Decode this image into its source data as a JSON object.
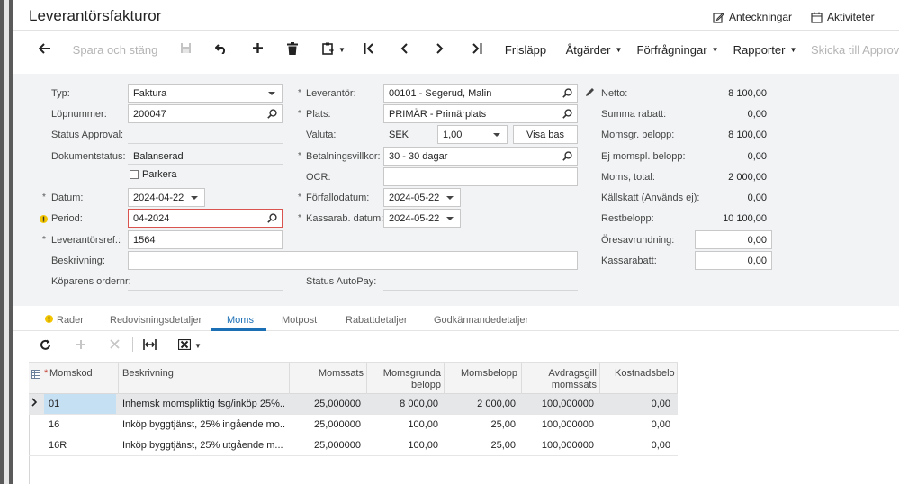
{
  "header": {
    "title": "Leverantörsfakturor",
    "notes_label": "Anteckningar",
    "activities_label": "Aktiviteter"
  },
  "toolbar": {
    "save_close": "Spara och stäng",
    "release": "Frisläpp",
    "actions": "Åtgärder",
    "inquiries": "Förfrågningar",
    "reports": "Rapporter",
    "send_approval": "Skicka till Approv"
  },
  "form": {
    "type_label": "Typ:",
    "type_value": "Faktura",
    "ref_label": "Löpnummer:",
    "ref_value": "200047",
    "status_approval_label": "Status Approval:",
    "doc_status_label": "Dokumentstatus:",
    "doc_status_value": "Balanserad",
    "hold_label": "Parkera",
    "date_label": "Datum:",
    "date_value": "2024-04-22",
    "period_label": "Period:",
    "period_value": "04-2024",
    "vendor_ref_label": "Leverantörsref.:",
    "vendor_ref_value": "1564",
    "description_label": "Beskrivning:",
    "buyer_order_label": "Köparens ordernr:",
    "vendor_label": "Leverantör:",
    "vendor_value": "00101 - Segerud, Malin",
    "location_label": "Plats:",
    "location_value": "PRIMÄR - Primärplats",
    "currency_label": "Valuta:",
    "currency_value": "SEK",
    "rate_value": "1,00",
    "view_base_label": "Visa bas",
    "terms_label": "Betalningsvillkor:",
    "terms_value": "30 - 30 dagar",
    "ocr_label": "OCR:",
    "due_date_label": "Förfallodatum:",
    "due_date_value": "2024-05-22",
    "cash_disc_date_label": "Kassarab. datum:",
    "cash_disc_date_value": "2024-05-22",
    "status_autopay_label": "Status AutoPay:"
  },
  "summary": {
    "net_label": "Netto:",
    "net_value": "8 100,00",
    "discount_total_label": "Summa rabatt:",
    "discount_total_value": "0,00",
    "taxable_label": "Momsgr. belopp:",
    "taxable_value": "8 100,00",
    "exempt_label": "Ej momspl. belopp:",
    "exempt_value": "0,00",
    "tax_total_label": "Moms, total:",
    "tax_total_value": "2 000,00",
    "withholding_label": "Källskatt (Används ej):",
    "withholding_value": "0,00",
    "balance_label": "Restbelopp:",
    "balance_value": "10 100,00",
    "rounding_label": "Öresavrundning:",
    "rounding_value": "0,00",
    "cash_discount_label": "Kassarabatt:",
    "cash_discount_value": "0,00"
  },
  "tabs": [
    "Rader",
    "Redovisningsdetaljer",
    "Moms",
    "Motpost",
    "Rabattdetaljer",
    "Godkännandedetaljer"
  ],
  "grid": {
    "headers": {
      "tax_id": "Momskod",
      "description": "Beskrivning",
      "rate": "Momssats",
      "taxable_1": "Momsgrunda",
      "taxable_2": "belopp",
      "tax_amount": "Momsbelopp",
      "deductible_1": "Avdragsgill",
      "deductible_2": "momssats",
      "expense": "Kostnadsbelo"
    },
    "rows": [
      {
        "tax_id": "01",
        "description": "Inhemsk momspliktig fsg/inköp 25%...",
        "rate": "25,000000",
        "taxable": "8 000,00",
        "tax_amount": "2 000,00",
        "deductible": "100,000000",
        "expense": "0,00"
      },
      {
        "tax_id": "16",
        "description": "Inköp byggtjänst, 25% ingående mo...",
        "rate": "25,000000",
        "taxable": "100,00",
        "tax_amount": "25,00",
        "deductible": "100,000000",
        "expense": "0,00"
      },
      {
        "tax_id": "16R",
        "description": "Inköp byggtjänst, 25% utgående m...",
        "rate": "25,000000",
        "taxable": "100,00",
        "tax_amount": "25,00",
        "deductible": "100,000000",
        "expense": "0,00"
      }
    ]
  },
  "colors": {
    "accent": "#1a6fb5",
    "error": "#d9534f",
    "warning": "#f2c500",
    "form_bg": "#f1f3f4",
    "selected_cell": "#c5dff3"
  }
}
